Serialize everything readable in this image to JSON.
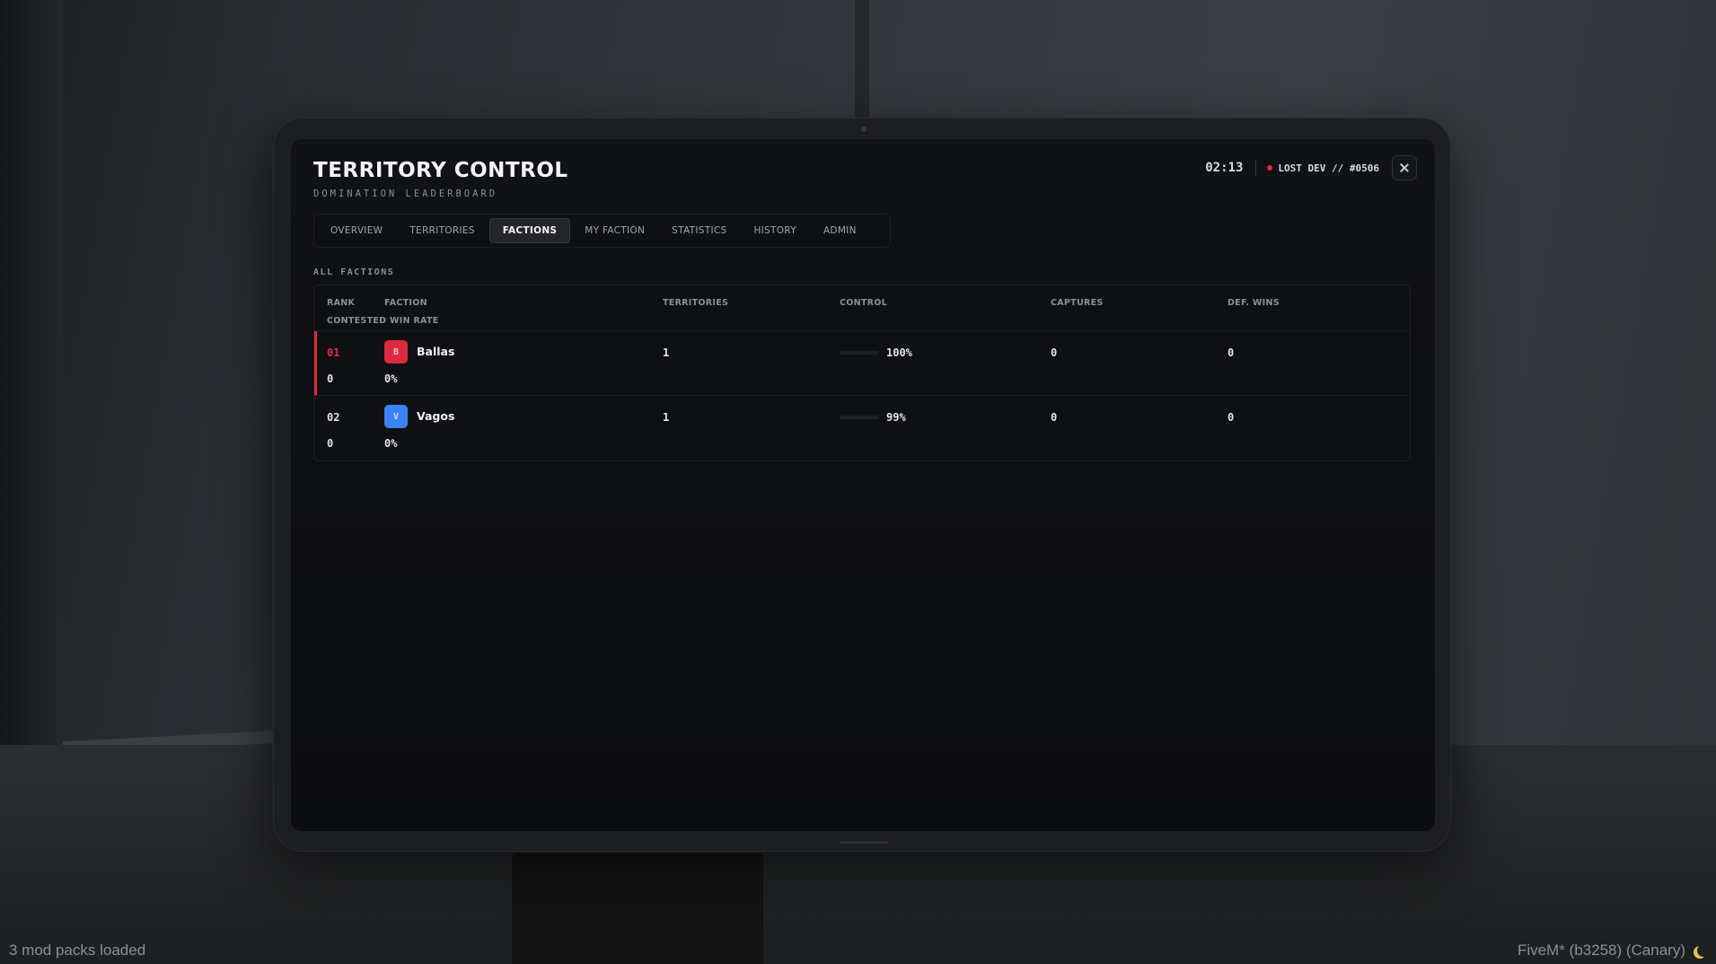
{
  "overlay": {
    "mods_text": "3 mod packs loaded",
    "client_text": "FiveM* (b3258) (Canary)",
    "moon_icon": "moon-icon"
  },
  "header": {
    "title": "TERRITORY CONTROL",
    "subtitle": "DOMINATION LEADERBOARD",
    "clock": "02:13",
    "server": "LOST DEV // #0506",
    "status_color": "#e02b3c",
    "close_icon": "close-icon"
  },
  "tabs": [
    {
      "label": "OVERVIEW",
      "active": false
    },
    {
      "label": "TERRITORIES",
      "active": false
    },
    {
      "label": "FACTIONS",
      "active": true
    },
    {
      "label": "MY FACTION",
      "active": false
    },
    {
      "label": "STATISTICS",
      "active": false
    },
    {
      "label": "HISTORY",
      "active": false
    },
    {
      "label": "ADMIN",
      "active": false
    }
  ],
  "section_label": "ALL FACTIONS",
  "table": {
    "headers": {
      "rank": "RANK",
      "faction": "FACTION",
      "territories": "TERRITORIES",
      "control": "CONTROL",
      "captures": "CAPTURES",
      "def_wins": "DEF. WINS",
      "contested": "CONTESTED WIN RATE"
    },
    "rows": [
      {
        "rank": "01",
        "badge": "B",
        "name": "Ballas",
        "color": "#e0283f",
        "territories": "1",
        "control_pct": 100,
        "control": "100%",
        "captures": "0",
        "def_wins": "0",
        "contested": "0",
        "win_rate": "0%"
      },
      {
        "rank": "02",
        "badge": "V",
        "name": "Vagos",
        "color": "#3b82f6",
        "territories": "1",
        "control_pct": 99,
        "control": "99%",
        "captures": "0",
        "def_wins": "0",
        "contested": "0",
        "win_rate": "0%"
      }
    ]
  }
}
